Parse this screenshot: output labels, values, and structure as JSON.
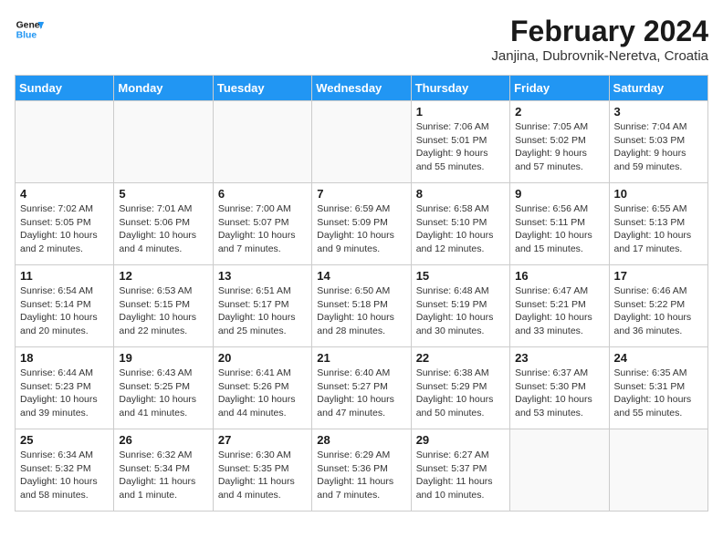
{
  "header": {
    "logo_line1": "General",
    "logo_line2": "Blue",
    "title": "February 2024",
    "subtitle": "Janjina, Dubrovnik-Neretva, Croatia"
  },
  "days_of_week": [
    "Sunday",
    "Monday",
    "Tuesday",
    "Wednesday",
    "Thursday",
    "Friday",
    "Saturday"
  ],
  "weeks": [
    [
      {
        "day": "",
        "info": ""
      },
      {
        "day": "",
        "info": ""
      },
      {
        "day": "",
        "info": ""
      },
      {
        "day": "",
        "info": ""
      },
      {
        "day": "1",
        "info": "Sunrise: 7:06 AM\nSunset: 5:01 PM\nDaylight: 9 hours and 55 minutes."
      },
      {
        "day": "2",
        "info": "Sunrise: 7:05 AM\nSunset: 5:02 PM\nDaylight: 9 hours and 57 minutes."
      },
      {
        "day": "3",
        "info": "Sunrise: 7:04 AM\nSunset: 5:03 PM\nDaylight: 9 hours and 59 minutes."
      }
    ],
    [
      {
        "day": "4",
        "info": "Sunrise: 7:02 AM\nSunset: 5:05 PM\nDaylight: 10 hours and 2 minutes."
      },
      {
        "day": "5",
        "info": "Sunrise: 7:01 AM\nSunset: 5:06 PM\nDaylight: 10 hours and 4 minutes."
      },
      {
        "day": "6",
        "info": "Sunrise: 7:00 AM\nSunset: 5:07 PM\nDaylight: 10 hours and 7 minutes."
      },
      {
        "day": "7",
        "info": "Sunrise: 6:59 AM\nSunset: 5:09 PM\nDaylight: 10 hours and 9 minutes."
      },
      {
        "day": "8",
        "info": "Sunrise: 6:58 AM\nSunset: 5:10 PM\nDaylight: 10 hours and 12 minutes."
      },
      {
        "day": "9",
        "info": "Sunrise: 6:56 AM\nSunset: 5:11 PM\nDaylight: 10 hours and 15 minutes."
      },
      {
        "day": "10",
        "info": "Sunrise: 6:55 AM\nSunset: 5:13 PM\nDaylight: 10 hours and 17 minutes."
      }
    ],
    [
      {
        "day": "11",
        "info": "Sunrise: 6:54 AM\nSunset: 5:14 PM\nDaylight: 10 hours and 20 minutes."
      },
      {
        "day": "12",
        "info": "Sunrise: 6:53 AM\nSunset: 5:15 PM\nDaylight: 10 hours and 22 minutes."
      },
      {
        "day": "13",
        "info": "Sunrise: 6:51 AM\nSunset: 5:17 PM\nDaylight: 10 hours and 25 minutes."
      },
      {
        "day": "14",
        "info": "Sunrise: 6:50 AM\nSunset: 5:18 PM\nDaylight: 10 hours and 28 minutes."
      },
      {
        "day": "15",
        "info": "Sunrise: 6:48 AM\nSunset: 5:19 PM\nDaylight: 10 hours and 30 minutes."
      },
      {
        "day": "16",
        "info": "Sunrise: 6:47 AM\nSunset: 5:21 PM\nDaylight: 10 hours and 33 minutes."
      },
      {
        "day": "17",
        "info": "Sunrise: 6:46 AM\nSunset: 5:22 PM\nDaylight: 10 hours and 36 minutes."
      }
    ],
    [
      {
        "day": "18",
        "info": "Sunrise: 6:44 AM\nSunset: 5:23 PM\nDaylight: 10 hours and 39 minutes."
      },
      {
        "day": "19",
        "info": "Sunrise: 6:43 AM\nSunset: 5:25 PM\nDaylight: 10 hours and 41 minutes."
      },
      {
        "day": "20",
        "info": "Sunrise: 6:41 AM\nSunset: 5:26 PM\nDaylight: 10 hours and 44 minutes."
      },
      {
        "day": "21",
        "info": "Sunrise: 6:40 AM\nSunset: 5:27 PM\nDaylight: 10 hours and 47 minutes."
      },
      {
        "day": "22",
        "info": "Sunrise: 6:38 AM\nSunset: 5:29 PM\nDaylight: 10 hours and 50 minutes."
      },
      {
        "day": "23",
        "info": "Sunrise: 6:37 AM\nSunset: 5:30 PM\nDaylight: 10 hours and 53 minutes."
      },
      {
        "day": "24",
        "info": "Sunrise: 6:35 AM\nSunset: 5:31 PM\nDaylight: 10 hours and 55 minutes."
      }
    ],
    [
      {
        "day": "25",
        "info": "Sunrise: 6:34 AM\nSunset: 5:32 PM\nDaylight: 10 hours and 58 minutes."
      },
      {
        "day": "26",
        "info": "Sunrise: 6:32 AM\nSunset: 5:34 PM\nDaylight: 11 hours and 1 minute."
      },
      {
        "day": "27",
        "info": "Sunrise: 6:30 AM\nSunset: 5:35 PM\nDaylight: 11 hours and 4 minutes."
      },
      {
        "day": "28",
        "info": "Sunrise: 6:29 AM\nSunset: 5:36 PM\nDaylight: 11 hours and 7 minutes."
      },
      {
        "day": "29",
        "info": "Sunrise: 6:27 AM\nSunset: 5:37 PM\nDaylight: 11 hours and 10 minutes."
      },
      {
        "day": "",
        "info": ""
      },
      {
        "day": "",
        "info": ""
      }
    ]
  ]
}
